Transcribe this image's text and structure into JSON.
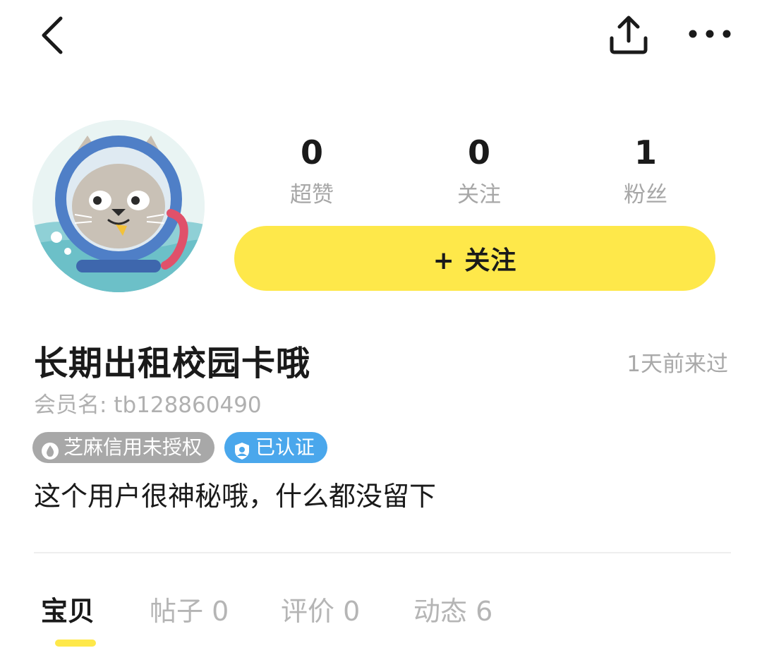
{
  "header": {
    "back_icon": "chevron-left-icon",
    "share_icon": "share-upload-icon",
    "more_icon": "more-dots-icon"
  },
  "stats": [
    {
      "value": "0",
      "label": "超赞"
    },
    {
      "value": "0",
      "label": "关注"
    },
    {
      "value": "1",
      "label": "粉丝"
    }
  ],
  "follow_button": {
    "label": "+ 关注",
    "color": "#fee84a"
  },
  "profile": {
    "name": "长期出租校园卡哦",
    "last_seen": "1天前来过",
    "member": "会员名: tb128860490",
    "bio": "这个用户很神秘哦，什么都没留下"
  },
  "badges": {
    "zhima": {
      "label": "芝麻信用未授权",
      "icon": "flame-drop-icon",
      "color": "#a8a8a8"
    },
    "verified": {
      "label": "已认证",
      "icon": "verified-user-icon",
      "color": "#4aa7ec"
    }
  },
  "tabs": [
    {
      "label": "宝贝",
      "active": true
    },
    {
      "label": "帖子 0",
      "active": false
    },
    {
      "label": "评价 0",
      "active": false
    },
    {
      "label": "动态 6",
      "active": false
    }
  ],
  "colors": {
    "accent": "#fee84a",
    "muted_text": "#a7a7a7"
  }
}
